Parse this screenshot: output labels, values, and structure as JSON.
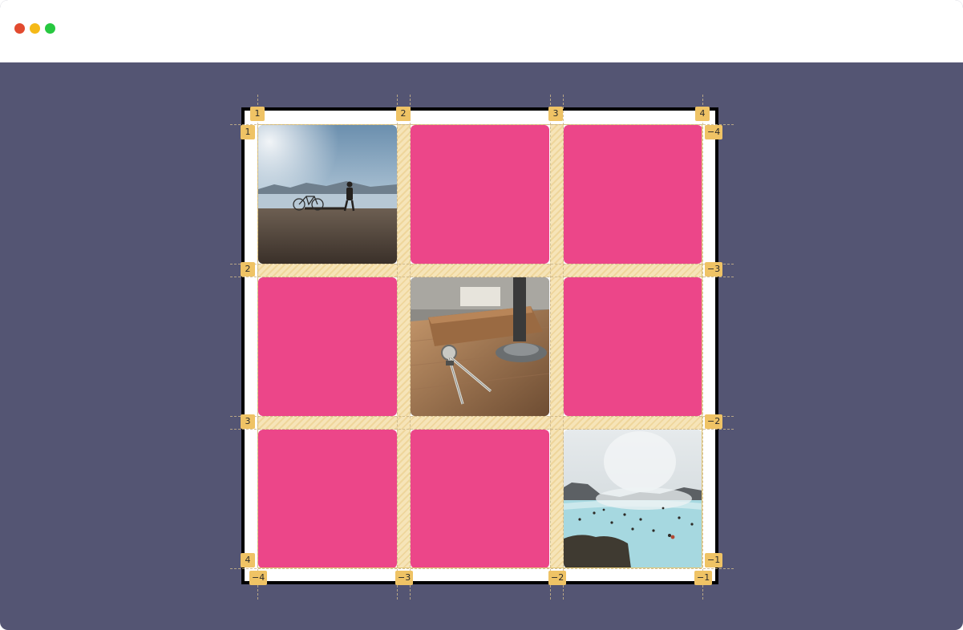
{
  "window": {
    "controls": [
      "close",
      "minimize",
      "maximize"
    ],
    "colors": {
      "close": "#e24a2f",
      "minimize": "#f5b917",
      "maximize": "#27c840",
      "background": "#545573"
    }
  },
  "grid": {
    "columns": 3,
    "rows": 3,
    "cell_color": "#ec4689",
    "gap_color": "#f6e4b8",
    "cells": [
      {
        "row": 1,
        "col": 1,
        "type": "photo",
        "image": "bicycle-by-sea"
      },
      {
        "row": 1,
        "col": 2,
        "type": "color"
      },
      {
        "row": 1,
        "col": 3,
        "type": "color"
      },
      {
        "row": 2,
        "col": 1,
        "type": "color"
      },
      {
        "row": 2,
        "col": 2,
        "type": "photo",
        "image": "compass-on-desk"
      },
      {
        "row": 2,
        "col": 3,
        "type": "color"
      },
      {
        "row": 3,
        "col": 1,
        "type": "color"
      },
      {
        "row": 3,
        "col": 2,
        "type": "color"
      },
      {
        "row": 3,
        "col": 3,
        "type": "photo",
        "image": "hot-spring-lagoon"
      }
    ]
  },
  "line_numbers": {
    "columns_top": [
      "1",
      "2",
      "3",
      "4"
    ],
    "columns_bottom": [
      "−4",
      "−3",
      "−2",
      "−1"
    ],
    "rows_left": [
      "1",
      "2",
      "3",
      "4"
    ],
    "rows_right": [
      "−4",
      "−3",
      "−2",
      "−1"
    ]
  }
}
